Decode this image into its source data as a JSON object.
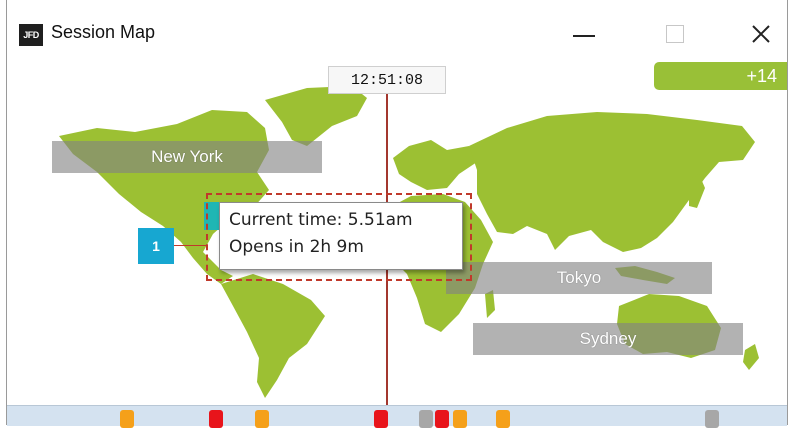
{
  "window": {
    "logo_text": "JFD",
    "title": "Session Map",
    "controls": {
      "minimize": "minimize",
      "maximize": "maximize",
      "close": "✕"
    }
  },
  "map": {
    "current_time": "12:51:08",
    "more_badge": "+14",
    "sessions": [
      {
        "name": "New York"
      },
      {
        "name": "Tokyo"
      },
      {
        "name": "Sydney"
      }
    ],
    "tooltip": {
      "line1": "Current time: 5.51am",
      "line2": "Opens in 2h 9m"
    },
    "callout_number": "1"
  },
  "colors": {
    "land": "#9cc033",
    "time_line": "#a3372e",
    "badge_green": "#99c037",
    "label_gray": "#828282",
    "teal": "#1fb6b4",
    "callout_blue": "#17a7d1",
    "marker_orange": "#f5a01a",
    "marker_red": "#e8141b",
    "marker_gray": "#a7a7a7"
  },
  "timeline": {
    "markers": [
      {
        "color": "orange"
      },
      {
        "color": "red"
      },
      {
        "color": "orange"
      },
      {
        "color": "red"
      },
      {
        "color": "gray"
      },
      {
        "color": "red"
      },
      {
        "color": "orange"
      },
      {
        "color": "orange"
      },
      {
        "color": "gray"
      }
    ]
  }
}
